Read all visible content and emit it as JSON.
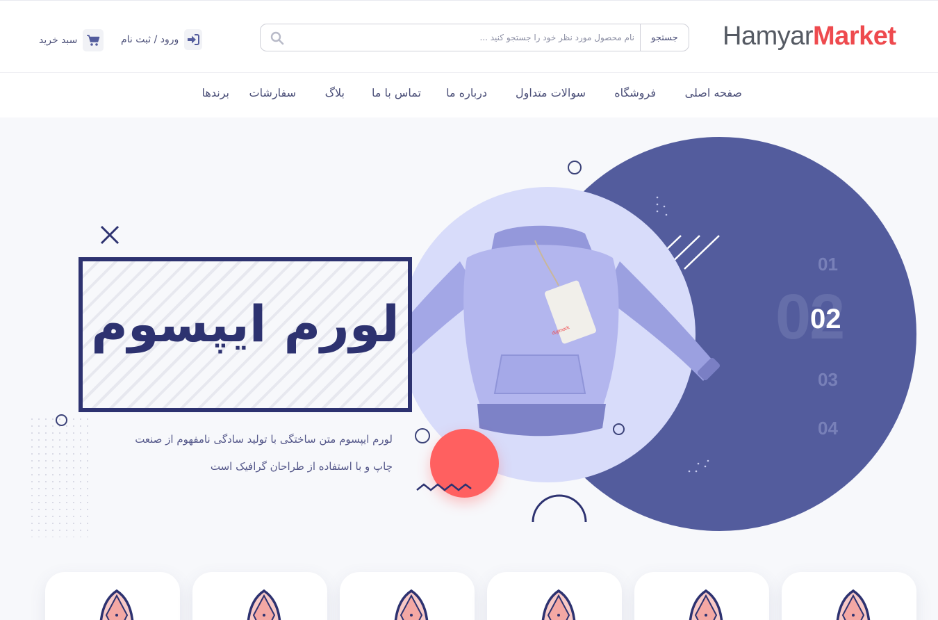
{
  "header": {
    "logo": {
      "part1": "Hamyar",
      "part2": "Market"
    },
    "search": {
      "button_label": "جستجو",
      "placeholder": "نام محصول مورد نظر خود را جستجو کنید ..."
    },
    "login_label": "ورود / ثبت نام",
    "cart_label": "سبد خرید"
  },
  "nav": {
    "items": [
      {
        "label": "صفحه اصلی"
      },
      {
        "label": "فروشگاه"
      },
      {
        "label": "سوالات متداول"
      },
      {
        "label": "درباره ما"
      },
      {
        "label": "تماس با ما"
      },
      {
        "label": "بلاگ"
      },
      {
        "label": "سفارشات"
      },
      {
        "label": "برندها"
      }
    ]
  },
  "hero": {
    "title": "لورم ایپسوم",
    "subtitle_line1": "لورم ایپسوم متن ساختگی با تولید سادگی نامفهوم از صنعت",
    "subtitle_line2": "چاپ و با استفاده از طراحان گرافیک است",
    "slides": {
      "items": [
        "01",
        "02",
        "03",
        "04"
      ],
      "active": "02",
      "ghost": "02"
    },
    "tag_text": "digimark"
  },
  "colors": {
    "brand_dark": "#555a63",
    "brand_accent": "#ee4a4e",
    "primary": "#535c9d",
    "navy": "#2d3270",
    "coral": "#ff6060",
    "lilac": "#d8dcfa"
  },
  "cards": {
    "count_visible": 6,
    "icon": "diamond-gem-icon"
  }
}
